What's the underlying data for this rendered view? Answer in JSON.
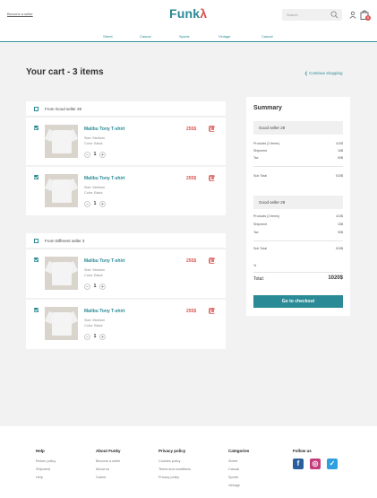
{
  "header": {
    "become_seller": "Become a seller",
    "logo_main": "Funk",
    "logo_accent": "λ",
    "search_placeholder": "Search",
    "cart_count": "0",
    "search_icon": "search-icon",
    "user_icon": "user-icon",
    "bag_icon": "shopping-bag-icon"
  },
  "nav": {
    "items": [
      "Street",
      "Casual",
      "Sports",
      "Vintage",
      "Casual"
    ]
  },
  "cart": {
    "title": "Your cart - 3 items",
    "continue": "❮ Continue shopping",
    "sellers": [
      {
        "name": "From Good seller 28",
        "items": [
          {
            "name": "Malibu Tony T-shirt",
            "size": "Size: Medium",
            "color": "Color: Black",
            "qty": "1",
            "price": "255$"
          },
          {
            "name": "Malibu Tony T-shirt",
            "size": "Size: Medium",
            "color": "Color: Black",
            "qty": "1",
            "price": "255$"
          }
        ]
      },
      {
        "name": "From Different seller 3",
        "items": [
          {
            "name": "Malibu Tony T-shirt",
            "size": "Size: Medium",
            "color": "Color: Black",
            "qty": "1",
            "price": "255$"
          },
          {
            "name": "Malibu Tony T-shirt",
            "size": "Size: Medium",
            "color": "Color: Black",
            "qty": "1",
            "price": "255$"
          }
        ]
      }
    ]
  },
  "summary": {
    "title": "Summary",
    "groups": [
      {
        "seller": "Good seller 28",
        "products_label": "Products (2 items)",
        "products": "410$",
        "shipment_label": "Shipment",
        "shipment": "15$",
        "tax_label": "Tax",
        "tax": "90$",
        "subtotal_label": "Sub Total",
        "subtotal": "515$"
      },
      {
        "seller": "Good seller 28",
        "products_label": "Products (2 items)",
        "products": "410$",
        "shipment_label": "Shipment",
        "shipment": "15$",
        "tax_label": "Tax",
        "tax": "90$",
        "subtotal_label": "Sub Total",
        "subtotal": "515$"
      }
    ],
    "misc": "%",
    "total_label": "Total:",
    "total": "1020$",
    "checkout": "Go to checkout"
  },
  "footer": {
    "help": {
      "title": "Help",
      "links": [
        "Return policy",
        "Shipment",
        "Help"
      ]
    },
    "about": {
      "title": "About Funky",
      "links": [
        "Become a seller",
        "About us",
        "Career"
      ]
    },
    "privacy": {
      "title": "Privacy policy",
      "links": [
        "Cookies policy",
        "Terms and conditions",
        "Privacy policy"
      ]
    },
    "categories": {
      "title": "Categories",
      "links": [
        "Street",
        "Casual",
        "Sports",
        "Vintage"
      ]
    },
    "follow": {
      "title": "Follow us",
      "icons": [
        "facebook-icon",
        "instagram-icon",
        "twitter-icon"
      ]
    }
  },
  "colors": {
    "accent": "#2a8a95",
    "danger": "#d9534f"
  }
}
